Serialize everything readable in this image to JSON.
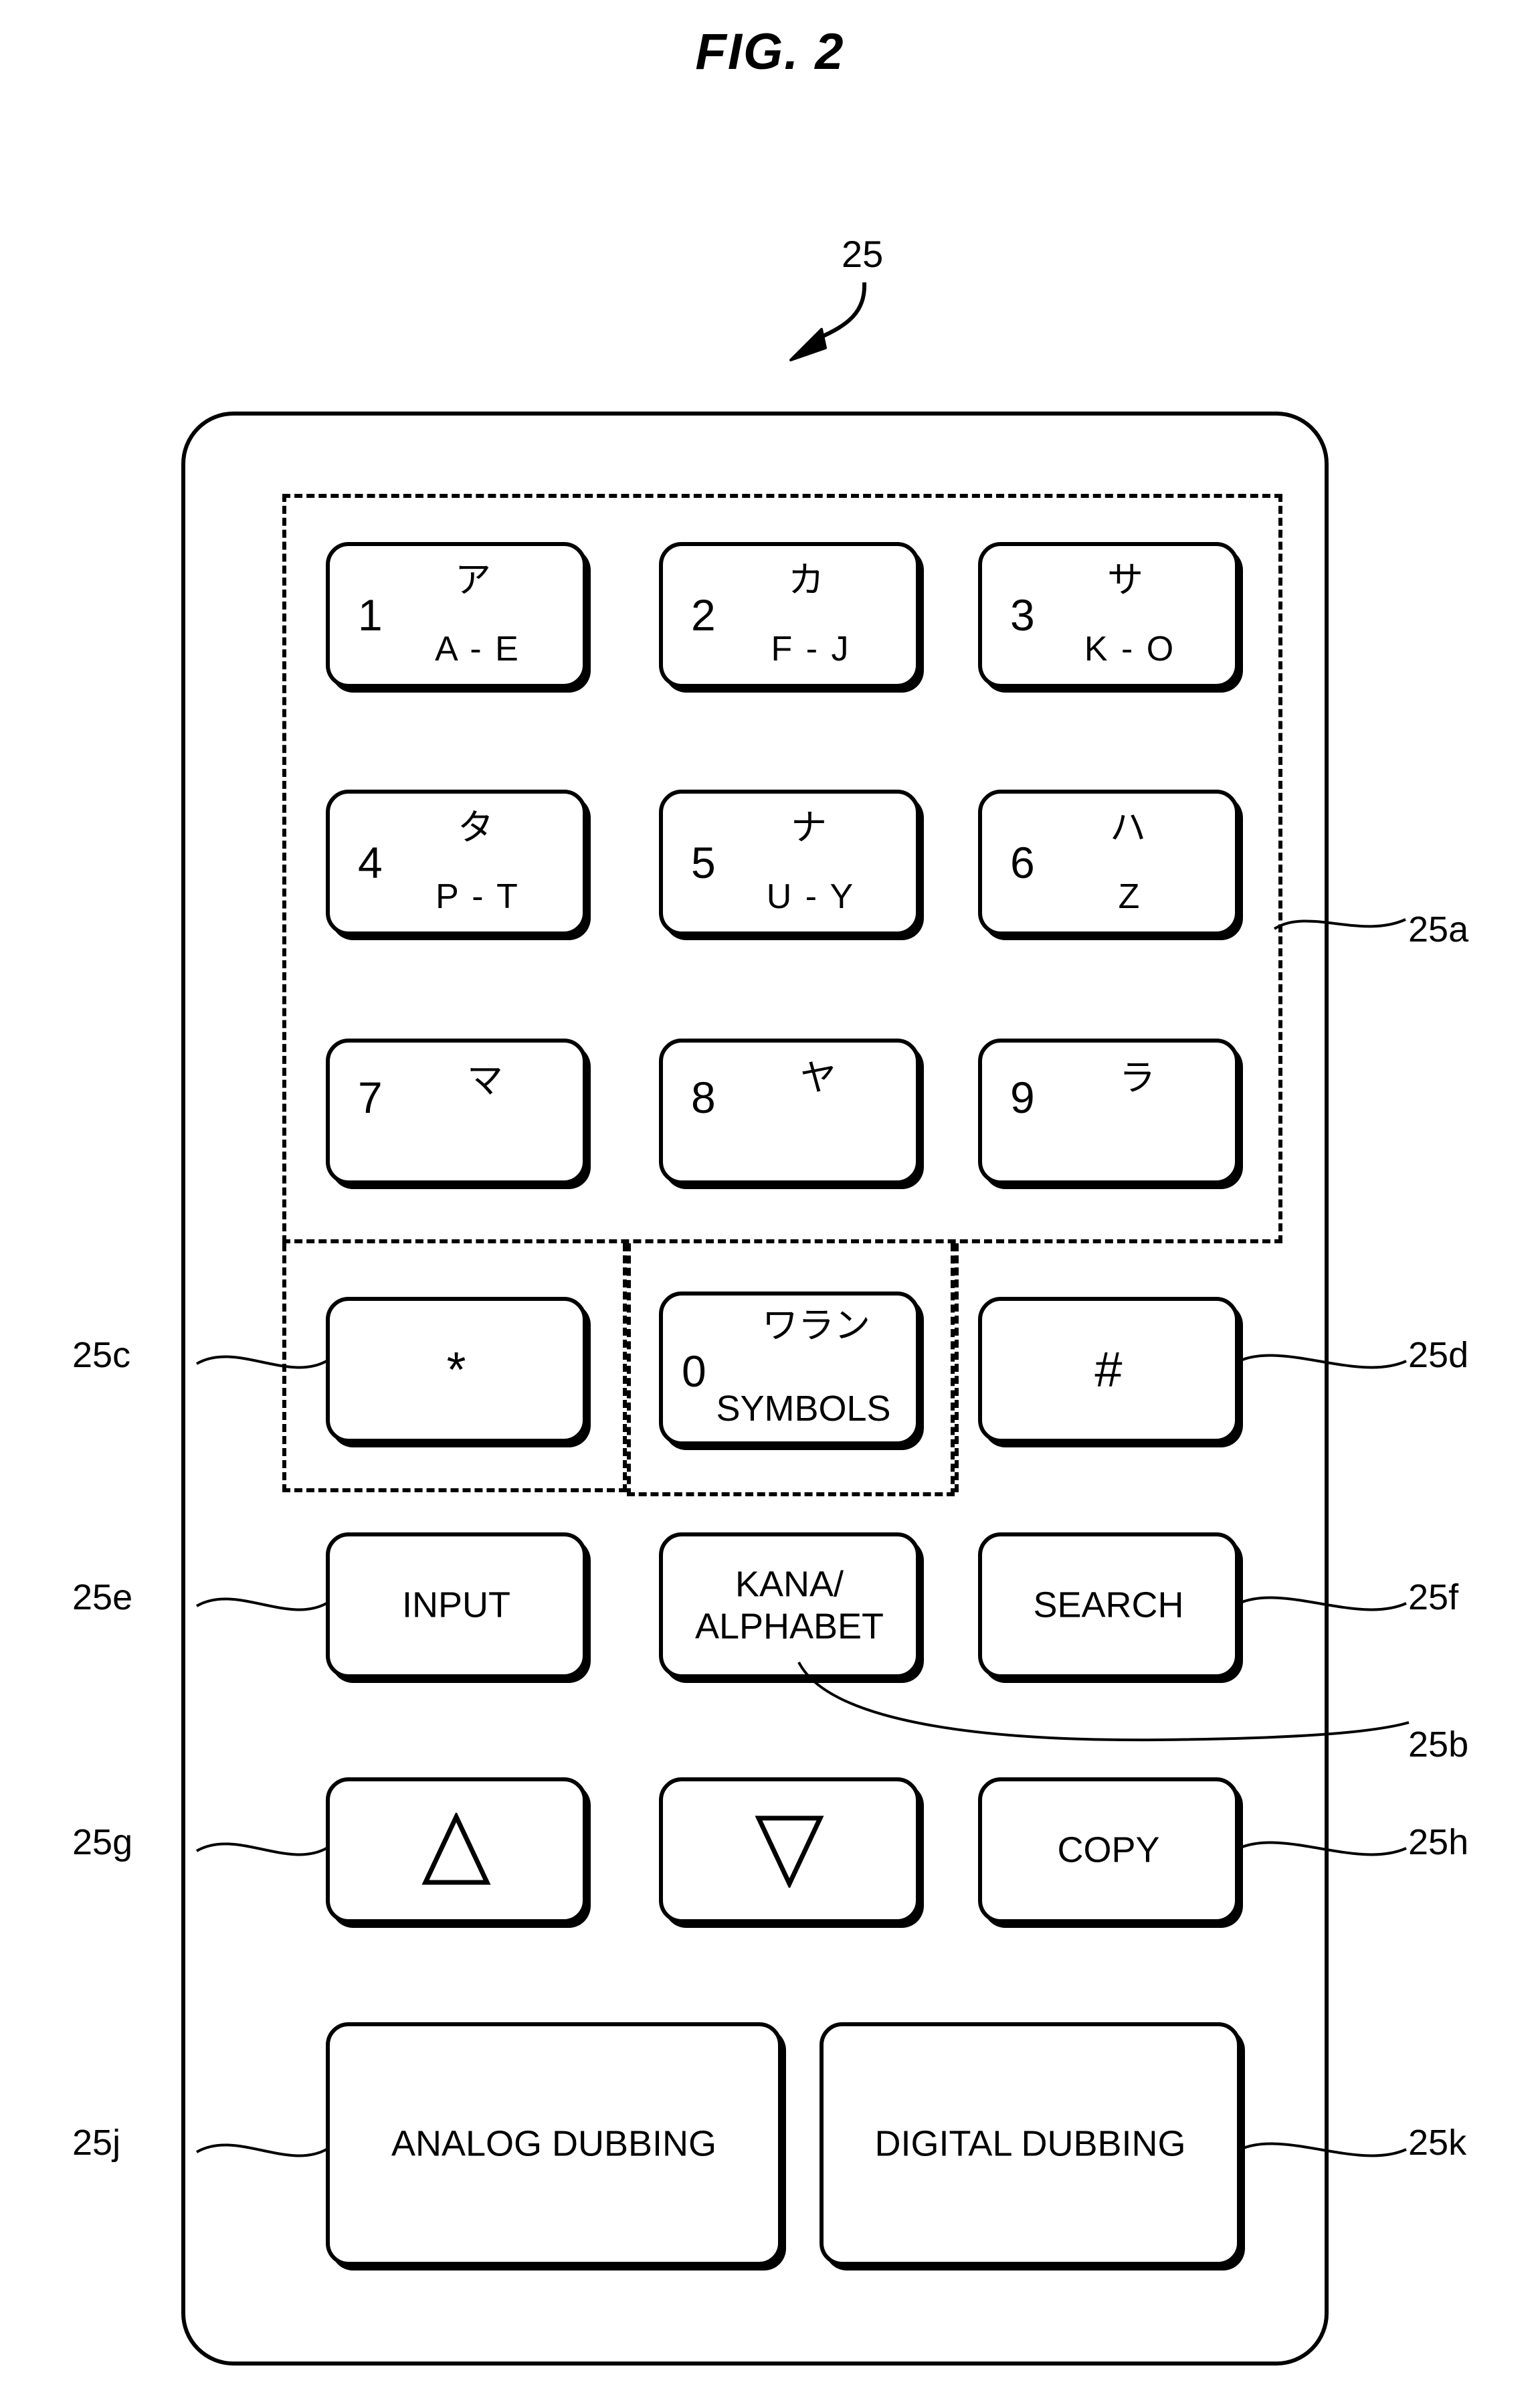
{
  "figure": {
    "title": "FIG. 2",
    "main_reference": "25"
  },
  "remote": {
    "numeric_keys": [
      {
        "digit": "1",
        "kana": "ア",
        "latin": "A - E"
      },
      {
        "digit": "2",
        "kana": "カ",
        "latin": "F - J"
      },
      {
        "digit": "3",
        "kana": "サ",
        "latin": "K - O"
      },
      {
        "digit": "4",
        "kana": "タ",
        "latin": "P - T"
      },
      {
        "digit": "5",
        "kana": "ナ",
        "latin": "U - Y"
      },
      {
        "digit": "6",
        "kana": "ハ",
        "latin": "Z"
      },
      {
        "digit": "7",
        "kana": "マ",
        "latin": ""
      },
      {
        "digit": "8",
        "kana": "ヤ",
        "latin": ""
      },
      {
        "digit": "9",
        "kana": "ラ",
        "latin": ""
      }
    ],
    "star_key": {
      "label": "*"
    },
    "zero_key": {
      "digit": "0",
      "kana": "ワラン",
      "symbols": "SYMBOLS"
    },
    "hash_key": {
      "label": "#"
    },
    "function_keys": {
      "input": "INPUT",
      "kana_alphabet_line1": "KANA/",
      "kana_alphabet_line2": "ALPHABET",
      "search": "SEARCH",
      "up": "triangle-up-icon",
      "down": "triangle-down-icon",
      "copy": "COPY",
      "analog_dubbing": "ANALOG DUBBING",
      "digital_dubbing": "DIGITAL DUBBING"
    }
  },
  "references": {
    "r25": "25",
    "r25a": "25a",
    "r25b": "25b",
    "r25c": "25c",
    "r25d": "25d",
    "r25e": "25e",
    "r25f": "25f",
    "r25g": "25g",
    "r25h": "25h",
    "r25j": "25j",
    "r25k": "25k"
  }
}
